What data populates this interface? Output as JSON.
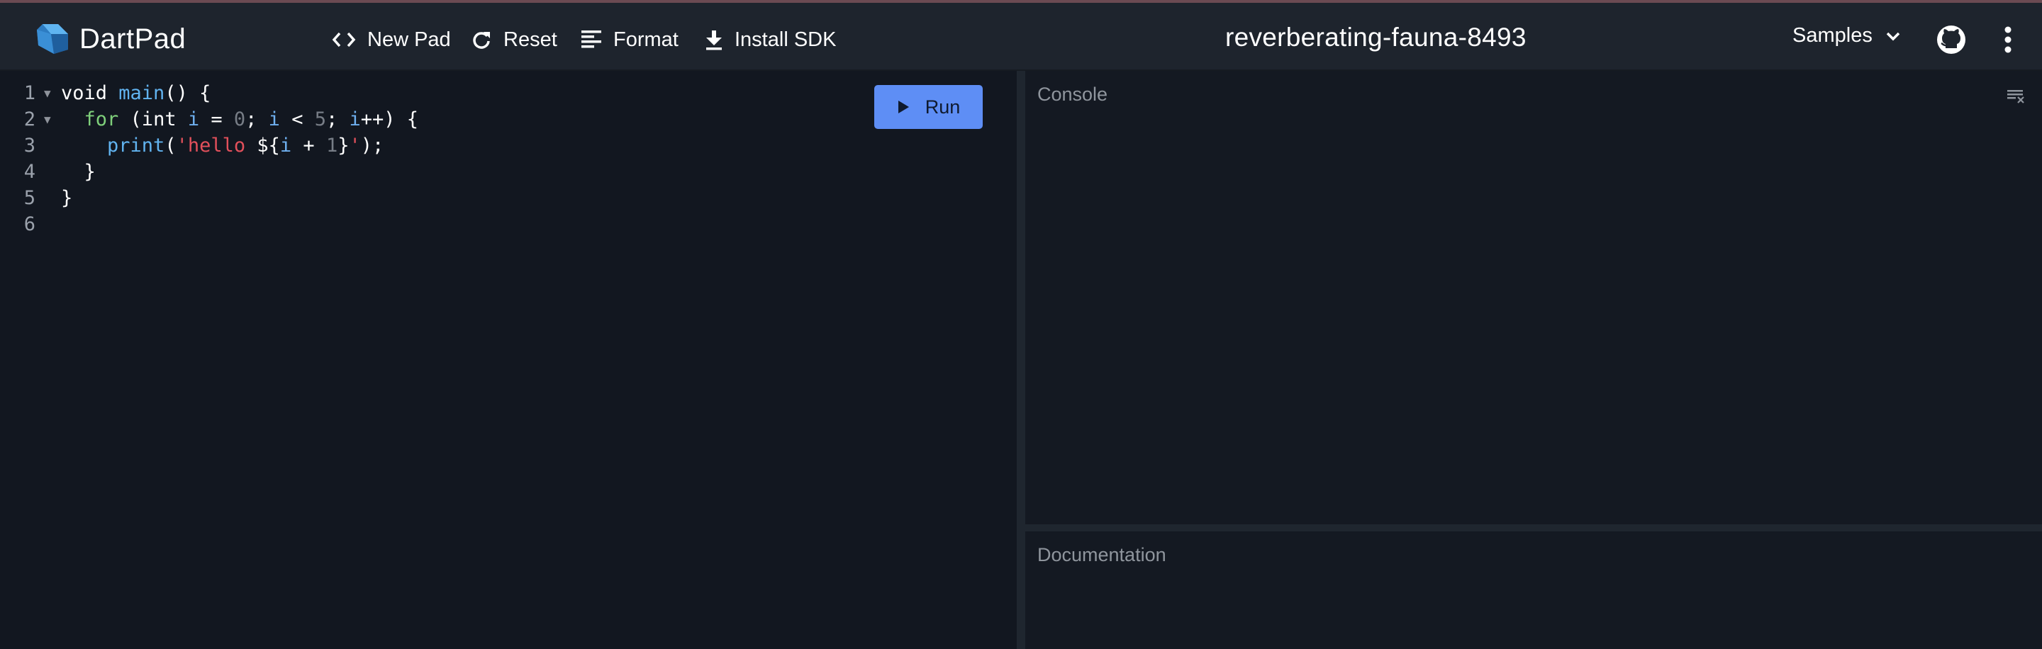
{
  "app": {
    "name": "DartPad"
  },
  "toolbar": {
    "new_pad": "New Pad",
    "reset": "Reset",
    "format": "Format",
    "install_sdk": "Install SDK"
  },
  "document": {
    "title": "reverberating-fauna-8493"
  },
  "menu": {
    "samples": "Samples"
  },
  "editor": {
    "line_numbers": [
      "1",
      "2",
      "3",
      "4",
      "5",
      "6"
    ],
    "lines": [
      [
        {
          "t": "void ",
          "c": ""
        },
        {
          "t": "main",
          "c": "kw-fn"
        },
        {
          "t": "() {",
          "c": ""
        }
      ],
      [
        {
          "t": "  ",
          "c": ""
        },
        {
          "t": "for",
          "c": "kw-green"
        },
        {
          "t": " (int ",
          "c": ""
        },
        {
          "t": "i",
          "c": "var"
        },
        {
          "t": " = ",
          "c": ""
        },
        {
          "t": "0",
          "c": "num"
        },
        {
          "t": "; ",
          "c": ""
        },
        {
          "t": "i",
          "c": "var"
        },
        {
          "t": " < ",
          "c": ""
        },
        {
          "t": "5",
          "c": "num"
        },
        {
          "t": "; ",
          "c": ""
        },
        {
          "t": "i",
          "c": "var"
        },
        {
          "t": "++) {",
          "c": ""
        }
      ],
      [
        {
          "t": "    ",
          "c": ""
        },
        {
          "t": "print",
          "c": "kw-fn"
        },
        {
          "t": "(",
          "c": ""
        },
        {
          "t": "'hello ",
          "c": "str"
        },
        {
          "t": "${",
          "c": ""
        },
        {
          "t": "i",
          "c": "var"
        },
        {
          "t": " + ",
          "c": ""
        },
        {
          "t": "1",
          "c": "num"
        },
        {
          "t": "}",
          "c": ""
        },
        {
          "t": "'",
          "c": "str"
        },
        {
          "t": ");",
          "c": ""
        }
      ],
      [
        {
          "t": "  }",
          "c": ""
        }
      ],
      [
        {
          "t": "}",
          "c": ""
        }
      ],
      [
        {
          "t": "",
          "c": ""
        }
      ]
    ],
    "run_label": "Run"
  },
  "console": {
    "label": "Console"
  },
  "documentation": {
    "label": "Documentation"
  },
  "colors": {
    "accent": "#5e8ef5",
    "appbar": "#1e242d",
    "editor_bg": "#121720",
    "string": "#e2505b",
    "function": "#61b3f0",
    "keyword": "#7fd07b"
  },
  "icons": [
    "dart-logo-icon",
    "code-brackets-icon",
    "reset-icon",
    "format-align-icon",
    "download-icon",
    "chevron-down-icon",
    "github-icon",
    "more-vert-icon",
    "play-icon",
    "clear-console-icon"
  ]
}
